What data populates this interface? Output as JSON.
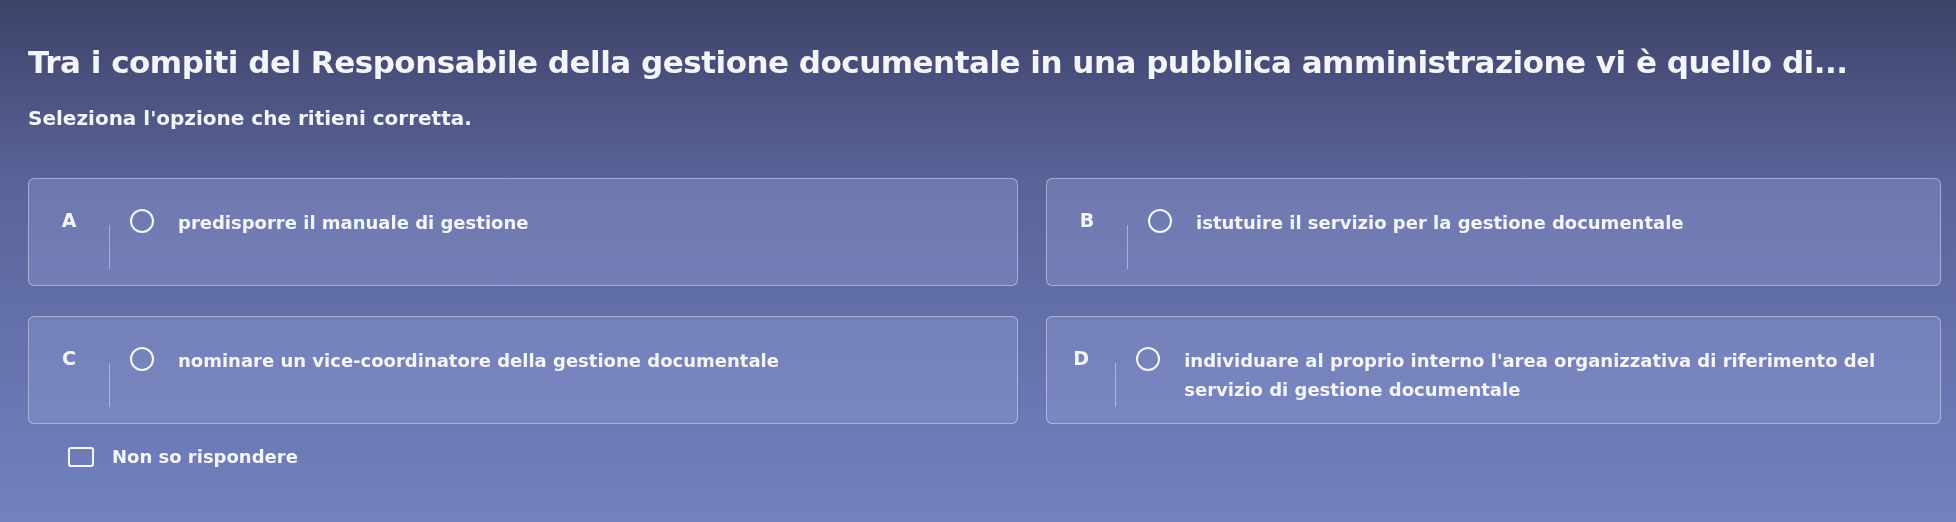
{
  "question": "Tra i compiti del Responsabile della gestione documentale in una pubblica amministrazione vi è quello di...",
  "instruction": "Seleziona l'opzione che ritieni corretta.",
  "options": [
    {
      "letter": "A",
      "text": "predisporre il manuale di gestione",
      "selected": false
    },
    {
      "letter": "B",
      "text": "istutuire il servizio per la gestione documentale",
      "selected": false
    },
    {
      "letter": "C",
      "text": "nominare un vice-coordinatore della gestione documentale",
      "selected": false
    },
    {
      "letter": "D",
      "text": "individuare al proprio interno l'area organizzativa di riferimento del servizio di gestione documentale",
      "selected": false
    }
  ],
  "dont_know": {
    "label": "Non so rispondere",
    "checked": false
  }
}
